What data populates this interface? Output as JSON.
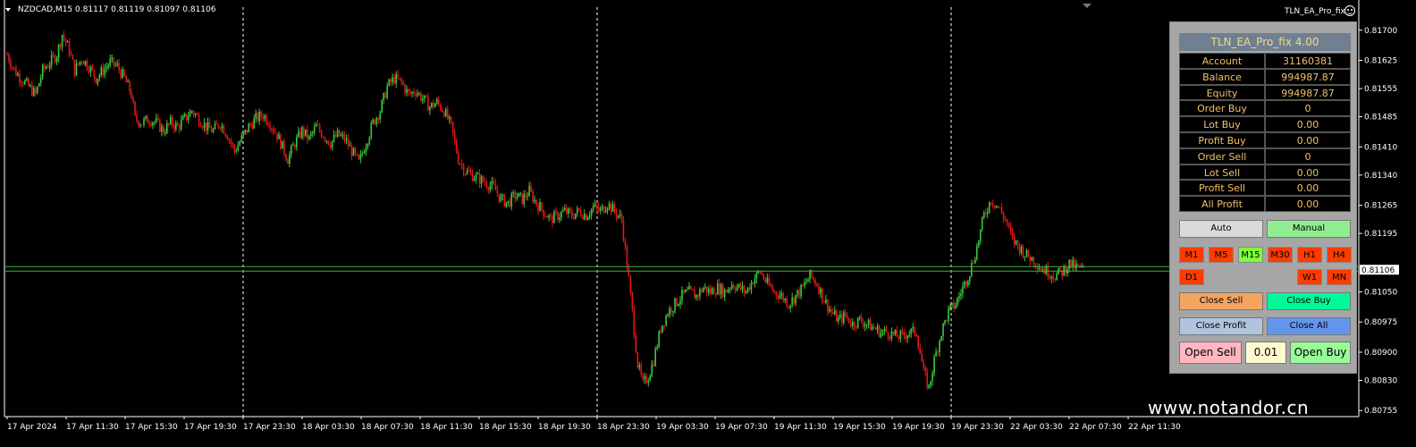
{
  "symbol_line": {
    "symbol": "NZDCAD,M15",
    "ohlc": "0.81117 0.81119 0.81097 0.81106"
  },
  "ea_label": "TLN_EA_Pro_fix",
  "watermark": "www.notandor.cn",
  "colors": {
    "background": "#000000",
    "bull_candle": "#3cc83c",
    "bear_candle": "#e01818",
    "current_price_line": "#3cb43c",
    "separator": "#ffffff",
    "panel_bg": "#a6a6a6",
    "panel_title_bg": "#708090",
    "panel_text": "#f1c06a",
    "tf_inactive": "#ff3b00",
    "tf_active": "#7dff3c"
  },
  "chart_data": {
    "type": "candlestick",
    "title": "NZDCAD,M15",
    "price_axis": {
      "ticks": [
        "0.81700",
        "0.81625",
        "0.81555",
        "0.81485",
        "0.81410",
        "0.81340",
        "0.81265",
        "0.81195",
        "0.81050",
        "0.80975",
        "0.80900",
        "0.80830",
        "0.80755"
      ],
      "tick_values": [
        0.817,
        0.81625,
        0.81555,
        0.81485,
        0.8141,
        0.8134,
        0.81265,
        0.81195,
        0.8105,
        0.80975,
        0.809,
        0.8083,
        0.80755
      ],
      "current_price": "0.81106",
      "current_price_value": 0.81106,
      "ylim": [
        0.8074,
        0.81735
      ]
    },
    "time_axis": {
      "labels": [
        "17 Apr 2024",
        "17 Apr 11:30",
        "17 Apr 15:30",
        "17 Apr 19:30",
        "17 Apr 23:30",
        "18 Apr 03:30",
        "18 Apr 07:30",
        "18 Apr 11:30",
        "18 Apr 15:30",
        "18 Apr 19:30",
        "18 Apr 23:30",
        "19 Apr 03:30",
        "19 Apr 07:30",
        "19 Apr 11:30",
        "19 Apr 15:30",
        "19 Apr 19:30",
        "19 Apr 23:30",
        "22 Apr 03:30",
        "22 Apr 07:30",
        "22 Apr 11:30"
      ],
      "day_separator_labels": [
        "17 Apr 23:30",
        "18 Apr 23:30",
        "19 Apr 23:30"
      ]
    },
    "close_path": [
      [
        0,
        0.8164
      ],
      [
        4,
        0.816
      ],
      [
        8,
        0.8158
      ],
      [
        12,
        0.8156
      ],
      [
        16,
        0.8154
      ],
      [
        20,
        0.816
      ],
      [
        24,
        0.8162
      ],
      [
        28,
        0.8164
      ],
      [
        31,
        0.8169
      ],
      [
        35,
        0.8165
      ],
      [
        38,
        0.816
      ],
      [
        42,
        0.8163
      ],
      [
        46,
        0.8161
      ],
      [
        50,
        0.8158
      ],
      [
        54,
        0.816
      ],
      [
        58,
        0.8162
      ],
      [
        62,
        0.8161
      ],
      [
        66,
        0.8158
      ],
      [
        70,
        0.8154
      ],
      [
        72,
        0.8148
      ],
      [
        76,
        0.8147
      ],
      [
        80,
        0.8148
      ],
      [
        84,
        0.8147
      ],
      [
        88,
        0.8145
      ],
      [
        92,
        0.8147
      ],
      [
        96,
        0.8146
      ],
      [
        100,
        0.8148
      ],
      [
        104,
        0.815
      ],
      [
        108,
        0.8148
      ],
      [
        112,
        0.8146
      ],
      [
        116,
        0.8145
      ],
      [
        120,
        0.8147
      ],
      [
        124,
        0.8144
      ],
      [
        128,
        0.814
      ],
      [
        132,
        0.8143
      ],
      [
        136,
        0.8146
      ],
      [
        140,
        0.8148
      ],
      [
        144,
        0.8149
      ],
      [
        148,
        0.8147
      ],
      [
        152,
        0.8144
      ],
      [
        156,
        0.814
      ],
      [
        158,
        0.8138
      ],
      [
        162,
        0.8142
      ],
      [
        166,
        0.8145
      ],
      [
        170,
        0.8143
      ],
      [
        174,
        0.8146
      ],
      [
        178,
        0.8144
      ],
      [
        182,
        0.8142
      ],
      [
        186,
        0.8144
      ],
      [
        190,
        0.8143
      ],
      [
        194,
        0.814
      ],
      [
        198,
        0.8137
      ],
      [
        202,
        0.8142
      ],
      [
        206,
        0.8147
      ],
      [
        210,
        0.815
      ],
      [
        214,
        0.8156
      ],
      [
        218,
        0.8158
      ],
      [
        222,
        0.8157
      ],
      [
        226,
        0.8154
      ],
      [
        230,
        0.8155
      ],
      [
        234,
        0.8153
      ],
      [
        238,
        0.8151
      ],
      [
        242,
        0.8152
      ],
      [
        246,
        0.815
      ],
      [
        250,
        0.8146
      ],
      [
        254,
        0.8138
      ],
      [
        258,
        0.8135
      ],
      [
        262,
        0.8134
      ],
      [
        266,
        0.8133
      ],
      [
        270,
        0.8132
      ],
      [
        274,
        0.8131
      ],
      [
        278,
        0.8128
      ],
      [
        282,
        0.8127
      ],
      [
        286,
        0.8129
      ],
      [
        290,
        0.8128
      ],
      [
        294,
        0.813
      ],
      [
        298,
        0.8127
      ],
      [
        302,
        0.8125
      ],
      [
        306,
        0.8123
      ],
      [
        310,
        0.8124
      ],
      [
        314,
        0.8125
      ],
      [
        318,
        0.8124
      ],
      [
        322,
        0.8125
      ],
      [
        326,
        0.8124
      ],
      [
        330,
        0.8126
      ],
      [
        334,
        0.8125
      ],
      [
        338,
        0.8127
      ],
      [
        342,
        0.8125
      ],
      [
        346,
        0.8123
      ],
      [
        350,
        0.8108
      ],
      [
        352,
        0.81
      ],
      [
        355,
        0.8087
      ],
      [
        358,
        0.8082
      ],
      [
        361,
        0.8084
      ],
      [
        364,
        0.8088
      ],
      [
        368,
        0.8096
      ],
      [
        372,
        0.81
      ],
      [
        376,
        0.8102
      ],
      [
        380,
        0.8104
      ],
      [
        384,
        0.8105
      ],
      [
        388,
        0.8104
      ],
      [
        392,
        0.8106
      ],
      [
        396,
        0.8105
      ],
      [
        400,
        0.8106
      ],
      [
        404,
        0.8105
      ],
      [
        408,
        0.8107
      ],
      [
        412,
        0.8106
      ],
      [
        416,
        0.8105
      ],
      [
        420,
        0.8108
      ],
      [
        424,
        0.811
      ],
      [
        428,
        0.8107
      ],
      [
        432,
        0.8105
      ],
      [
        436,
        0.8104
      ],
      [
        440,
        0.8102
      ],
      [
        444,
        0.8104
      ],
      [
        448,
        0.8106
      ],
      [
        452,
        0.8109
      ],
      [
        456,
        0.8107
      ],
      [
        460,
        0.8103
      ],
      [
        464,
        0.81
      ],
      [
        468,
        0.8098
      ],
      [
        472,
        0.8099
      ],
      [
        476,
        0.8097
      ],
      [
        480,
        0.8098
      ],
      [
        484,
        0.8097
      ],
      [
        488,
        0.8096
      ],
      [
        492,
        0.8095
      ],
      [
        496,
        0.8095
      ],
      [
        500,
        0.8094
      ],
      [
        504,
        0.8094
      ],
      [
        508,
        0.8095
      ],
      [
        512,
        0.8095
      ],
      [
        516,
        0.8085
      ],
      [
        519,
        0.8081
      ],
      [
        522,
        0.8088
      ],
      [
        526,
        0.8095
      ],
      [
        530,
        0.81
      ],
      [
        534,
        0.8102
      ],
      [
        538,
        0.8106
      ],
      [
        542,
        0.811
      ],
      [
        546,
        0.8116
      ],
      [
        550,
        0.8124
      ],
      [
        554,
        0.8128
      ],
      [
        558,
        0.8126
      ],
      [
        562,
        0.8123
      ],
      [
        566,
        0.8118
      ],
      [
        570,
        0.8116
      ],
      [
        574,
        0.8114
      ],
      [
        578,
        0.8113
      ],
      [
        582,
        0.8111
      ],
      [
        586,
        0.811
      ],
      [
        590,
        0.8109
      ],
      [
        594,
        0.811
      ],
      [
        598,
        0.8112
      ],
      [
        602,
        0.8111
      ],
      [
        606,
        0.81106
      ]
    ],
    "path_index_max": 606
  },
  "panel": {
    "title": "TLN_EA_Pro_fix 4.00",
    "rows": [
      {
        "label": "Account",
        "value": "31160381"
      },
      {
        "label": "Balance",
        "value": "994987.87"
      },
      {
        "label": "Equity",
        "value": "994987.87"
      },
      {
        "label": "Order Buy",
        "value": "0"
      },
      {
        "label": "Lot Buy",
        "value": "0.00"
      },
      {
        "label": "Profit Buy",
        "value": "0.00"
      },
      {
        "label": "Order Sell",
        "value": "0"
      },
      {
        "label": "Lot Sell",
        "value": "0.00"
      },
      {
        "label": "Profit Sell",
        "value": "0.00"
      },
      {
        "label": "All Profit",
        "value": "0.00"
      }
    ],
    "mode": {
      "auto": "Auto",
      "manual": "Manual"
    },
    "timeframes": [
      "M1",
      "M5",
      "M15",
      "M30",
      "H1",
      "H4",
      "D1",
      "W1",
      "MN"
    ],
    "active_timeframe": "M15",
    "actions": {
      "close_sell": "Close Sell",
      "close_buy": "Close Buy",
      "close_profit": "Close Profit",
      "close_all": "Close All",
      "open_sell": "Open Sell",
      "lot": "0.01",
      "open_buy": "Open Buy"
    }
  }
}
